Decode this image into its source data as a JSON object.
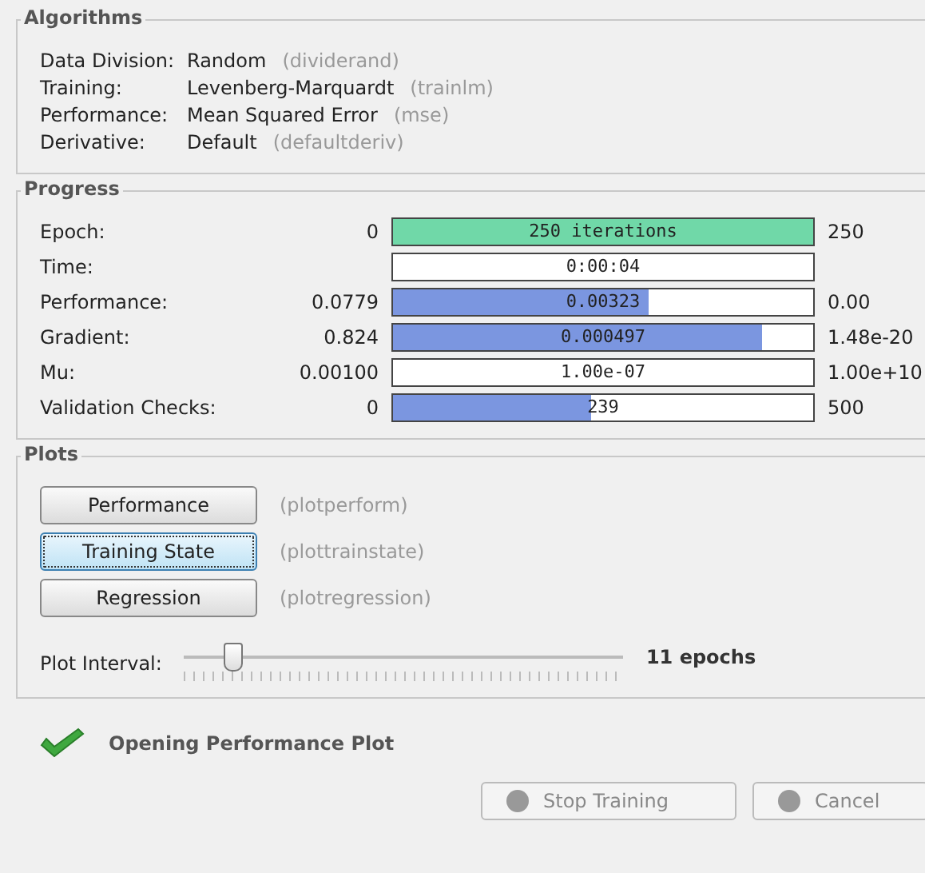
{
  "algorithms": {
    "title": "Algorithms",
    "rows": [
      {
        "label": "Data Division:",
        "value": "Random",
        "function": "(dividerand)"
      },
      {
        "label": "Training:",
        "value": "Levenberg-Marquardt",
        "function": "(trainlm)"
      },
      {
        "label": "Performance:",
        "value": "Mean Squared Error",
        "function": "(mse)"
      },
      {
        "label": "Derivative:",
        "value": "Default",
        "function": "(defaultderiv)"
      }
    ]
  },
  "progress": {
    "title": "Progress",
    "rows": [
      {
        "label": "Epoch:",
        "start": "0",
        "reading": "250 iterations",
        "level": 1,
        "color": "#70d8a8",
        "end": "250"
      },
      {
        "label": "Time:",
        "reading": "0:00:04"
      },
      {
        "label": "Performance:",
        "start": "0.0779",
        "reading": "0.00323",
        "level": 0.61,
        "color": "#7b96e0",
        "end": "0.00"
      },
      {
        "label": "Gradient:",
        "start": "0.824",
        "reading": "0.000497",
        "level": 0.88,
        "color": "#7b96e0",
        "end": "1.48e-20"
      },
      {
        "label": "Mu:",
        "start": "0.00100",
        "reading": "1.00e-07",
        "end": "1.00e+10"
      },
      {
        "label": "Validation Checks:",
        "start": "0",
        "reading": "239",
        "level": 0.47,
        "color": "#7b96e0",
        "end": "500"
      }
    ]
  },
  "plots": {
    "title": "Plots",
    "buttons": [
      {
        "label": "Performance",
        "function": "(plotperform)",
        "selected": false
      },
      {
        "label": "Training State",
        "function": "(plottrainstate)",
        "selected": true
      },
      {
        "label": "Regression",
        "function": "(plotregression)",
        "selected": false
      }
    ],
    "interval": {
      "label": "Plot Interval:",
      "level": 0.11,
      "reading": "11 epochs"
    }
  },
  "status": {
    "message": "Opening Performance Plot"
  },
  "buttons": [
    {
      "label": "Stop Training",
      "disabled": true
    },
    {
      "label": "Cancel",
      "disabled": true
    }
  ]
}
